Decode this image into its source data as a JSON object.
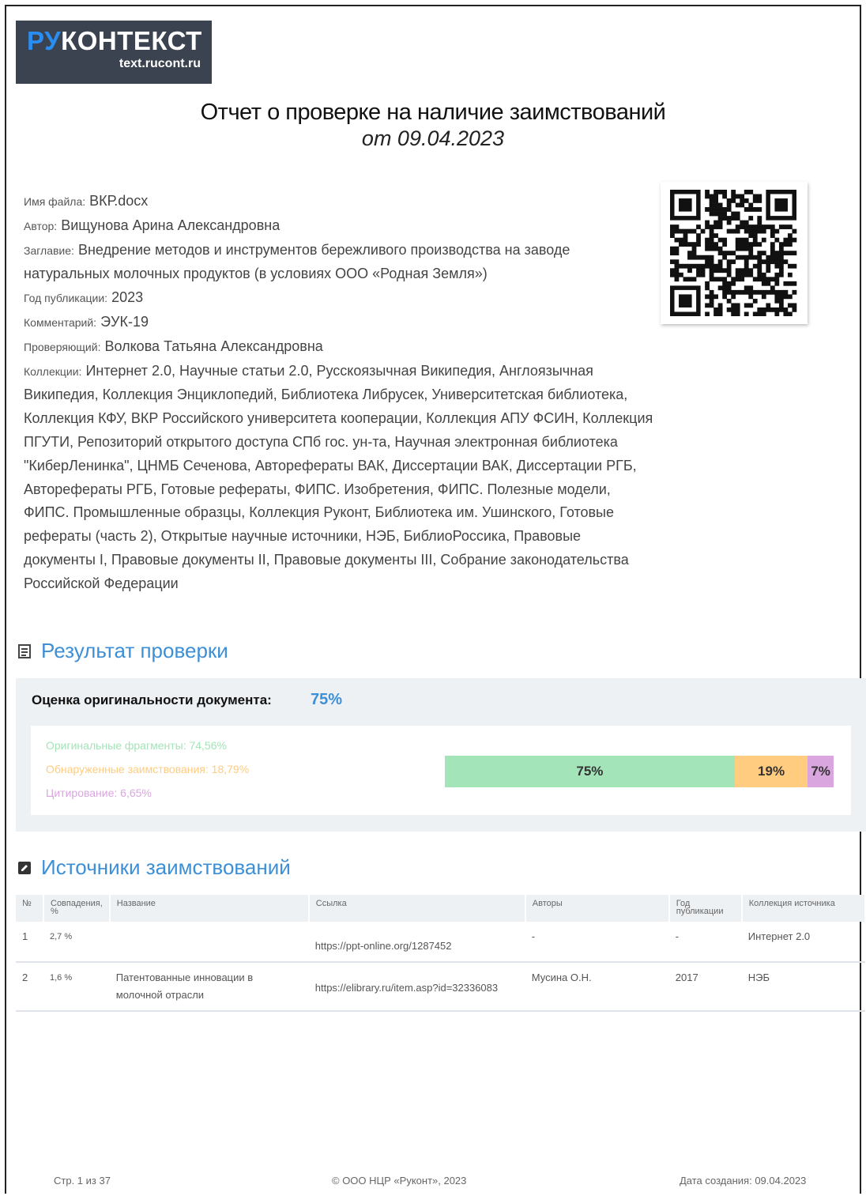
{
  "logo": {
    "main_ru": "РУ",
    "main_rest": "КОНТЕКСТ",
    "sub": "text.rucont.ru"
  },
  "title": "Отчет о проверке на наличие заимствований",
  "subtitle": "от 09.04.2023",
  "meta": {
    "file_label": "Имя файла:",
    "file": "ВКР.docx",
    "author_label": "Автор:",
    "author": "Вищунова Арина Александровна",
    "heading_label": "Заглавие:",
    "heading": "Внедрение методов и инструментов бережливого производства на заводе натуральных молочных продуктов (в условиях ООО «Родная Земля»)",
    "year_label": "Год публикации:",
    "year": "2023",
    "comment_label": "Комментарий:",
    "comment": "ЭУК-19",
    "checker_label": "Проверяющий:",
    "checker": "Волкова Татьяна Александровна",
    "collections_label": "Коллекции:",
    "collections": "Интернет 2.0, Научные статьи 2.0, Русскоязычная Википедия, Англоязычная Википедия, Коллекция Энциклопедий, Библиотека Либрусек, Университетская библиотека, Коллекция КФУ, ВКР Российского университета кооперации, Коллекция АПУ ФСИН, Коллекция ПГУТИ, Репозиторий открытого доступа СПб гос. ун-та, Научная электронная библиотека \"КиберЛенинка\", ЦНМБ Сеченова, Авторефераты ВАК, Диссертации ВАК, Диссертации РГБ, Авторефераты РГБ, Готовые рефераты, ФИПС. Изобретения, ФИПС. Полезные модели, ФИПС. Промышленные образцы, Коллекция Руконт, Библиотека им. Ушинского, Готовые рефераты (часть 2), Открытые научные источники, НЭБ, БиблиоРоссика, Правовые документы I, Правовые документы II, Правовые документы III, Собрание законодательства Российской Федерации"
  },
  "result": {
    "heading": "Результат проверки",
    "score_label": "Оценка оригинальности документа:",
    "score_value": "75%",
    "legend": [
      {
        "text": "Оригинальные фрагменты: 74,56%",
        "color": "#a3e4b8"
      },
      {
        "text": "Обнаруженные заимствования: 18,79%",
        "color": "#ffcc80"
      },
      {
        "text": "Цитирование: 6,65%",
        "color": "#d9a6e0"
      }
    ],
    "bar": [
      {
        "label": "75%",
        "value": 74.56,
        "color": "#a3e4b8"
      },
      {
        "label": "19%",
        "value": 18.79,
        "color": "#ffcc80"
      },
      {
        "label": "7%",
        "value": 6.65,
        "color": "#d9a6e0"
      }
    ]
  },
  "sources": {
    "heading": "Источники заимствований",
    "columns": [
      "№",
      "Совпадения, %",
      "Название",
      "Ссылка",
      "Авторы",
      "Год публикации",
      "Коллекция источника"
    ],
    "rows": [
      {
        "num": "1",
        "match": "2,7 %",
        "name": "",
        "link": "https://ppt-online.org/1287452",
        "authors": "-",
        "year": "-",
        "collection": "Интернет 2.0"
      },
      {
        "num": "2",
        "match": "1,6 %",
        "name": "Патентованные инновации в молочной отрасли",
        "link": "https://elibrary.ru/item.asp?id=32336083",
        "authors": "Мусина О.Н.",
        "year": "2017",
        "collection": "НЭБ"
      }
    ]
  },
  "footer": {
    "page": "Стр. 1 из 37",
    "copyright": "© ООО НЦР «Руконт», 2023",
    "created": "Дата создания: 09.04.2023"
  }
}
